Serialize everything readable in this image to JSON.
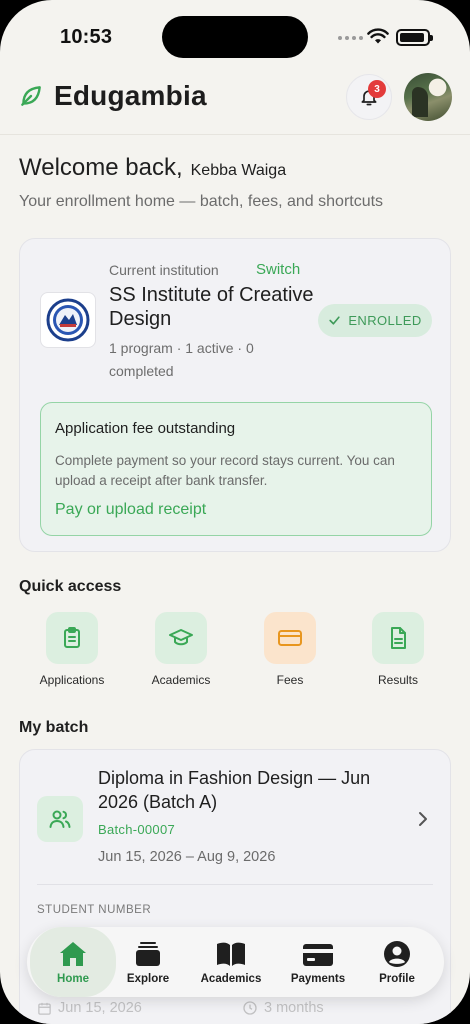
{
  "status_bar": {
    "time": "10:53"
  },
  "header": {
    "brand": "Edugambia",
    "notification_count": "3"
  },
  "welcome": {
    "greeting": "Welcome back,",
    "name": "Kebba Waiga",
    "subtitle": "Your enrollment home — batch, fees, and shortcuts"
  },
  "institution": {
    "current_label": "Current institution",
    "switch_label": "Switch",
    "name": "SS Institute of Creative Design",
    "stats": "1 program · 1 active · 0 completed",
    "status": "ENROLLED"
  },
  "alert": {
    "title": "Application fee outstanding",
    "body": "Complete payment so your record stays current. You can upload a receipt after bank transfer.",
    "action": "Pay or upload receipt"
  },
  "quick_access": {
    "title": "Quick access",
    "items": [
      {
        "label": "Applications",
        "icon": "clipboard-icon"
      },
      {
        "label": "Academics",
        "icon": "graduation-cap-icon"
      },
      {
        "label": "Fees",
        "icon": "card-icon"
      },
      {
        "label": "Results",
        "icon": "document-icon"
      }
    ]
  },
  "batch": {
    "title": "My batch",
    "name": "Diploma in Fashion Design — Jun 2026 (Batch A)",
    "code": "Batch-00007",
    "dates": "Jun 15, 2026 – Aug 9, 2026",
    "student_number_label": "STUDENT NUMBER",
    "start_date": "Jun 15, 2026",
    "duration": "3 months"
  },
  "tabbar": {
    "items": [
      {
        "label": "Home",
        "icon": "home-icon",
        "active": true
      },
      {
        "label": "Explore",
        "icon": "explore-icon",
        "active": false
      },
      {
        "label": "Academics",
        "icon": "book-icon",
        "active": false
      },
      {
        "label": "Payments",
        "icon": "payment-card-icon",
        "active": false
      },
      {
        "label": "Profile",
        "icon": "profile-icon",
        "active": false
      }
    ]
  },
  "colors": {
    "accent": "#3aa856",
    "background": "#f4f3ef",
    "badge": "#e33b3b",
    "fees_tile": "#fbe4cc"
  }
}
